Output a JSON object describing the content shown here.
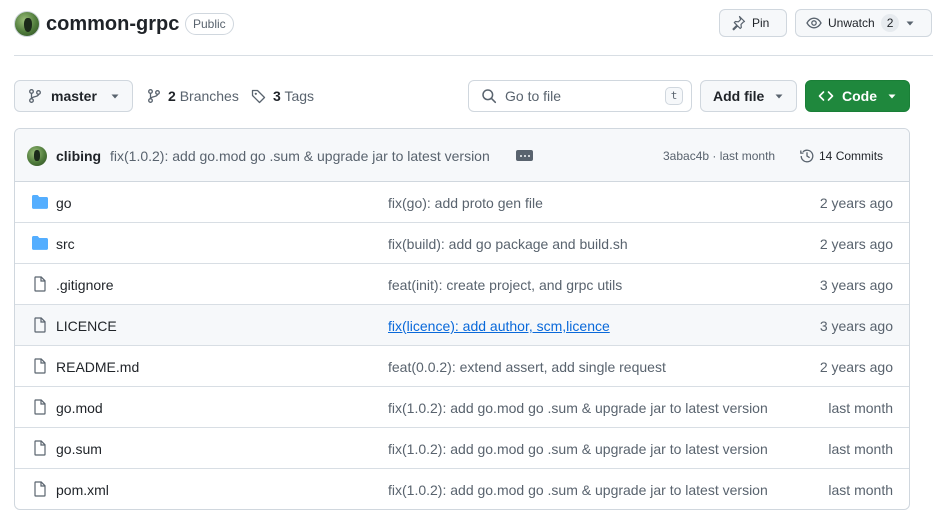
{
  "repo": {
    "name": "common-grpc",
    "visibility": "Public"
  },
  "header_actions": {
    "pin_label": "Pin",
    "watch_label": "Unwatch",
    "watch_count": "2"
  },
  "toolbar": {
    "branch": "master",
    "branches_count": "2",
    "branches_label": "Branches",
    "tags_count": "3",
    "tags_label": "Tags",
    "search_placeholder": "Go to file",
    "search_shortcut": "t",
    "add_file_label": "Add file",
    "code_label": "Code"
  },
  "latest_commit": {
    "author": "clibing",
    "message": "fix(1.0.2): add go.mod go .sum & upgrade jar to latest version",
    "hash": "3abac4b",
    "separator": " · ",
    "age": "last month",
    "commits_count": "14",
    "commits_label": "Commits"
  },
  "files": [
    {
      "type": "folder",
      "icon": "folder-icon",
      "name": "go",
      "commit": "fix(go): add proto gen file",
      "age": "2 years ago"
    },
    {
      "type": "folder",
      "icon": "folder-icon",
      "name": "src",
      "commit": "fix(build): add go package and build.sh",
      "age": "2 years ago"
    },
    {
      "type": "file",
      "icon": "file-icon",
      "name": ".gitignore",
      "commit": "feat(init): create project, and grpc utils",
      "age": "3 years ago"
    },
    {
      "type": "file",
      "icon": "file-icon",
      "name": "LICENCE",
      "commit": "fix(licence): add author, scm,licence",
      "age": "3 years ago"
    },
    {
      "type": "file",
      "icon": "file-icon",
      "name": "README.md",
      "commit": "feat(0.0.2): extend assert,   add single request",
      "age": "2 years ago"
    },
    {
      "type": "file",
      "icon": "file-icon",
      "name": "go.mod",
      "commit": "fix(1.0.2): add go.mod go .sum & upgrade jar to latest version",
      "age": "last month"
    },
    {
      "type": "file",
      "icon": "file-icon",
      "name": "go.sum",
      "commit": "fix(1.0.2): add go.mod go .sum & upgrade jar to latest version",
      "age": "last month"
    },
    {
      "type": "file",
      "icon": "file-icon",
      "name": "pom.xml",
      "commit": "fix(1.0.2): add go.mod go .sum & upgrade jar to latest version",
      "age": "last month"
    }
  ],
  "colors": {
    "accent_green": "#1f883d",
    "link_blue": "#0969da",
    "folder_blue": "#54aeff",
    "muted_text": "#59636e"
  }
}
